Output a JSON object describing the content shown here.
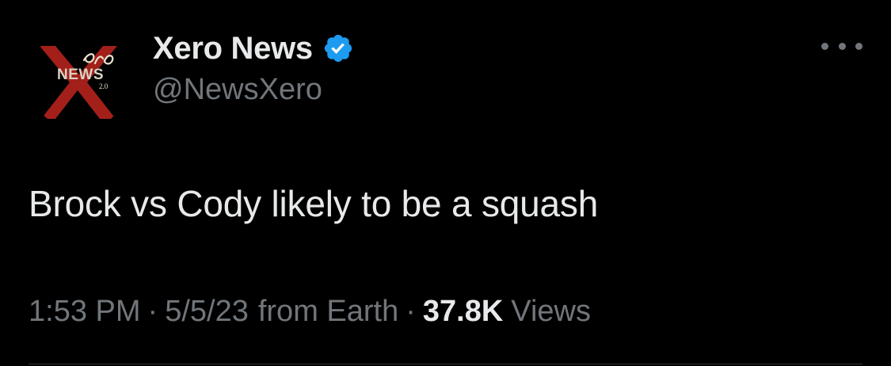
{
  "author": {
    "display_name": "Xero News",
    "handle": "@NewsXero",
    "verified": true,
    "avatar_logo_text": "Xero NEWS 2.0"
  },
  "tweet": {
    "text": "Brock vs Cody likely to be a squash"
  },
  "meta": {
    "time": "1:53 PM",
    "separator": "·",
    "date": "5/5/23",
    "source": "from Earth",
    "views_count": "37.8K",
    "views_label": "Views"
  },
  "icons": {
    "more": "more-horizontal-icon",
    "verified": "verified-badge-icon"
  },
  "colors": {
    "background": "#000000",
    "primary_text": "#e7e9ea",
    "secondary_text": "#71767b",
    "verified_blue": "#1d9bf0",
    "logo_red": "#a3201a"
  }
}
